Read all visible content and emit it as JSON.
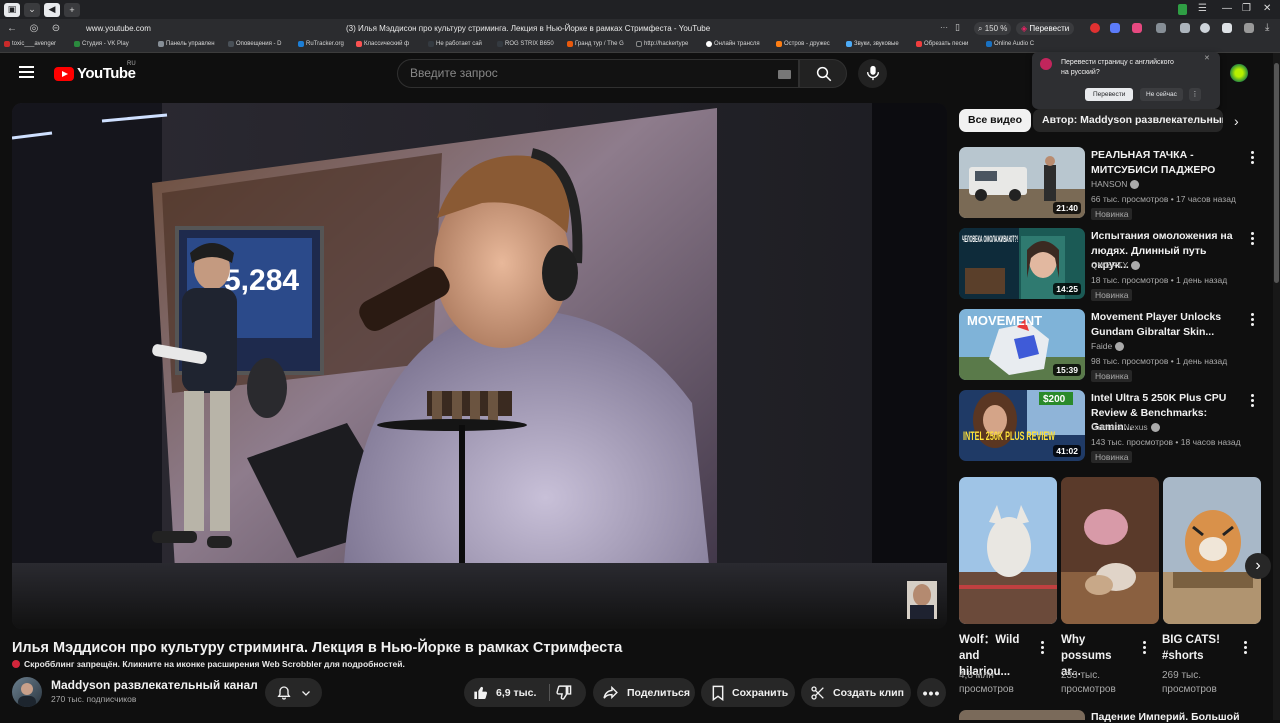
{
  "browser": {
    "url": "www.youtube.com",
    "page_title": "(3) Илья Мэддисон про культуру стриминга. Лекция в Нью-Йорке в рамках Стримфеста - YouTube",
    "zoom": "150 %",
    "translate_button": "Перевести",
    "bookmarks": [
      "toxic___avenger",
      "Студия - VK Play",
      "Панель управлен",
      "Оповещения - D",
      "RuTracker.org",
      "Классический ф",
      "Не работает сай",
      "ROG STRIX B650",
      "Гранд тур / The G",
      "http://hackertype",
      "Онлайн трансля",
      "Остров - дружес",
      "Звуки, звуковые",
      "Обрезать песни",
      "Online Audio C"
    ]
  },
  "translate_popup": {
    "text": "Перевести страницу с английского на русский?",
    "confirm": "Перевести",
    "dismiss": "Не сейчас"
  },
  "youtube": {
    "logo": "YouTube",
    "region": "RU",
    "search_placeholder": "Введите запрос"
  },
  "video": {
    "title": "Илья Мэддисон про культуру стриминга. Лекция в Нью-Йорке в рамках Стримфеста",
    "scrobbler_notice": "Скробблинг запрещён. Кликните на иконке расширения Web Scrobbler для подробностей.",
    "screen_number": "5,284",
    "channel_name": "Maddyson развлекательный канал",
    "subscribers": "270 тыс. подписчиков",
    "likes": "6,9 тыс.",
    "share": "Поделиться",
    "save": "Сохранить",
    "clip": "Создать клип"
  },
  "sidebar": {
    "chips": [
      "Все видео",
      "Автор: Maddyson развлекательный"
    ],
    "videos": [
      {
        "title": "РЕАЛЬНАЯ ТАЧКА - МИТСУБИСИ ПАДЖЕРО",
        "channel": "HANSON",
        "meta": "66 тыс. просмотров • 17 часов назад",
        "badge": "Новинка",
        "duration": "21:40"
      },
      {
        "title": "Испытания омоложения на людях. Длинный путь окрук...",
        "channel": "QWERTY",
        "meta": "18 тыс. просмотров • 1 день назад",
        "badge": "Новинка",
        "duration": "14:25",
        "thumb_text": "ЧЕЛОВЕКА ОМОЛАЖИВАЮТ?!"
      },
      {
        "title": "Movement Player Unlocks Gundam Gibraltar Skin...",
        "channel": "Faide",
        "meta": "98 тыс. просмотров • 1 день назад",
        "badge": "Новинка",
        "duration": "15:39",
        "thumb_text": "MOVEMENT"
      },
      {
        "title": "Intel Ultra 5 250K Plus CPU Review & Benchmarks: Gamin...",
        "channel": "Gamers Nexus",
        "meta": "143 тыс. просмотров • 18 часов назад",
        "badge": "Новинка",
        "duration": "41:02",
        "thumb_text": "INTEL 250K PLUS REVIEW",
        "thumb_price": "$200"
      }
    ],
    "shorts": [
      {
        "title": "Wolf：Wild and hilariou...",
        "views": "4,8 млн просмотров"
      },
      {
        "title": "Why possums ar...",
        "views": "233 тыс. просмотров"
      },
      {
        "title": "BIG CATS! #shorts",
        "views": "269 тыс. просмотров"
      }
    ],
    "next_title": "Падение Империй. Большой"
  }
}
